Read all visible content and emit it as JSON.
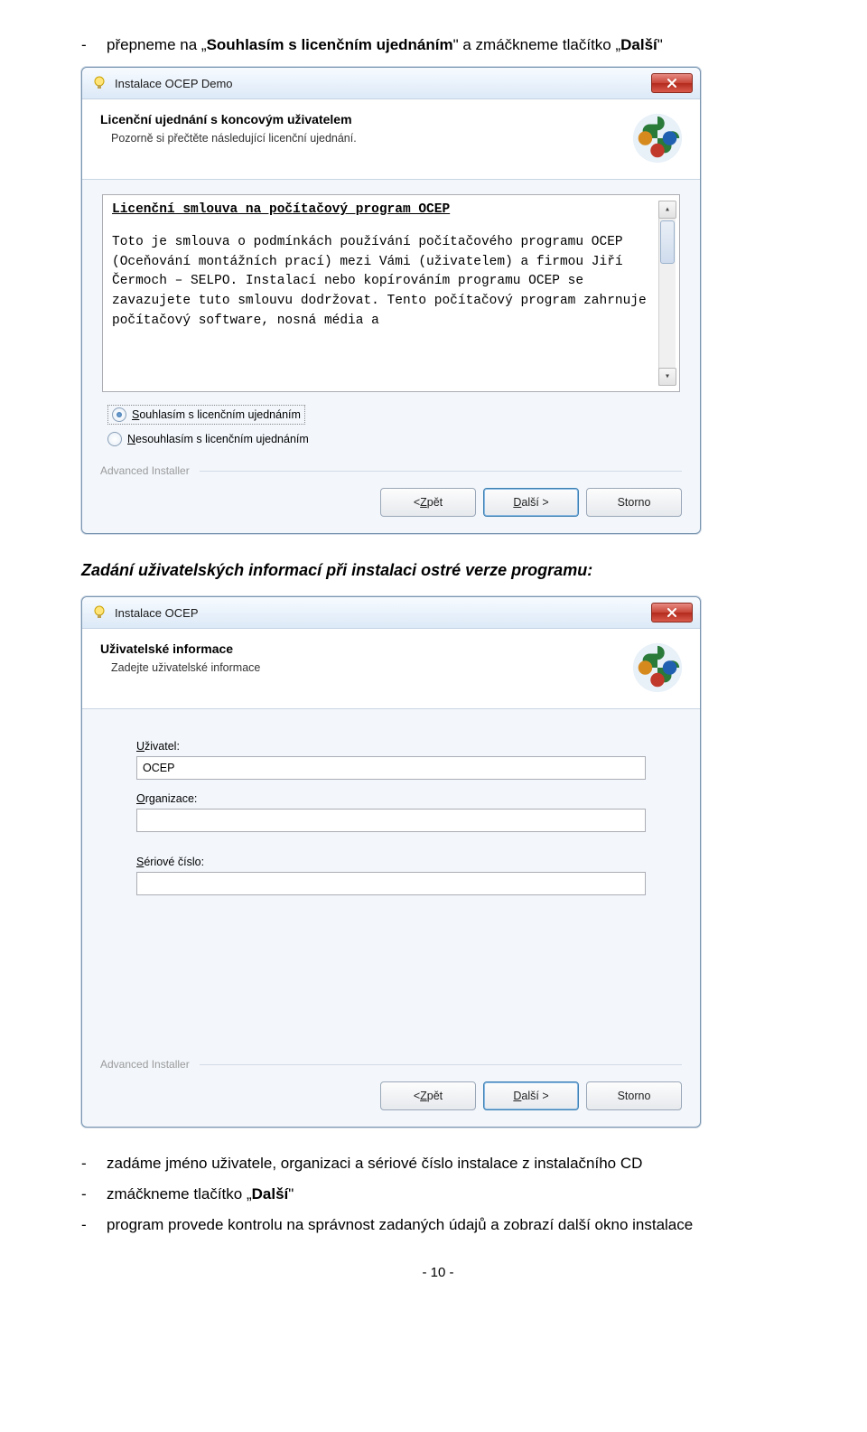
{
  "doc": {
    "bullet1_pre": "přepneme na „",
    "bullet1_bold": "Souhlasím s licenčním ujednáním",
    "bullet1_mid": "\" a zmáčkneme tlačítko „",
    "bullet1_bold2": "Další",
    "bullet1_post": "\"",
    "section_title": "Zadání uživatelských informací při instalaci ostré verze programu:",
    "bullet2": "zadáme jméno uživatele, organizaci a sériové číslo instalace z instalačního CD",
    "bullet3_pre": "zmáčkneme tlačítko „",
    "bullet3_bold": "Další",
    "bullet3_post": "\"",
    "bullet4": "program provede kontrolu na správnost zadaných údajů a zobrazí další okno instalace",
    "page_number": "- 10 -",
    "dash": "-"
  },
  "win1": {
    "title": "Instalace OCEP Demo",
    "hp_title": "Licenční ujednání s koncovým uživatelem",
    "hp_sub": "Pozorně si přečtěte následující licenční ujednání.",
    "license_heading": "Licenční smlouva na počítačový program OCEP",
    "license_body": "Toto je smlouva o podmínkách používání počítačového programu OCEP (Oceňování montážních prací) mezi Vámi (uživatelem) a firmou Jiří Čermoch – SELPO. Instalací nebo kopírováním programu OCEP se zavazujete tuto smlouvu dodržovat. Tento počítačový program zahrnuje počítačový software, nosná média a",
    "radio_agree_pre": "S",
    "radio_agree_rest": "ouhlasím s licenčním ujednáním",
    "radio_disagree_pre": "N",
    "radio_disagree_rest": "esouhlasím s licenčním ujednáním",
    "ai": "Advanced Installer",
    "btn_back_pre": "< ",
    "btn_back_u": "Z",
    "btn_back_rest": "pět",
    "btn_next_u": "D",
    "btn_next_rest": "alší >",
    "btn_cancel": "Storno",
    "scroll_up": "▴",
    "scroll_down": "▾"
  },
  "win2": {
    "title": "Instalace OCEP",
    "hp_title": "Uživatelské informace",
    "hp_sub": "Zadejte uživatelské informace",
    "label_user_pre": "U",
    "label_user_rest": "živatel:",
    "user_value": "OCEP",
    "label_org_pre": "O",
    "label_org_rest": "rganizace:",
    "org_value": "",
    "label_serial_pre": "S",
    "label_serial_rest": "ériové číslo:",
    "serial_value": "",
    "ai": "Advanced Installer",
    "btn_back_pre": "< ",
    "btn_back_u": "Z",
    "btn_back_rest": "pět",
    "btn_next_u": "D",
    "btn_next_rest": "alší >",
    "btn_cancel": "Storno"
  }
}
